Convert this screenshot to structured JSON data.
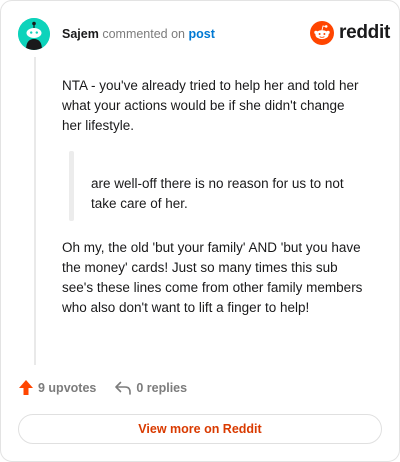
{
  "comment": {
    "author": "Sajem",
    "verb": "commented on",
    "target": "post",
    "brand": "reddit",
    "paragraphs": [
      "NTA - you've already tried to help her and told her what your actions would be if she didn't change her lifestyle.",
      "Oh my, the old 'but your family' AND 'but you have the money' cards! Just so many times this sub see's these lines come from other family members who also don't want to lift a finger to help!"
    ],
    "quote": "are well-off there is no reason for us to not take care of her."
  },
  "actions": {
    "upvotes": "9 upvotes",
    "replies": "0 replies"
  },
  "footer": {
    "view_more": "View more on Reddit"
  },
  "colors": {
    "brand": "#ff4500",
    "avatar": "#0dd3bb",
    "link": "#0079d3",
    "cta": "#d93a00"
  },
  "icons": {
    "avatar": "snoo-avatar-icon",
    "brand": "reddit-logo-icon",
    "upvote": "upvote-arrow-icon",
    "reply": "reply-arrow-icon"
  }
}
